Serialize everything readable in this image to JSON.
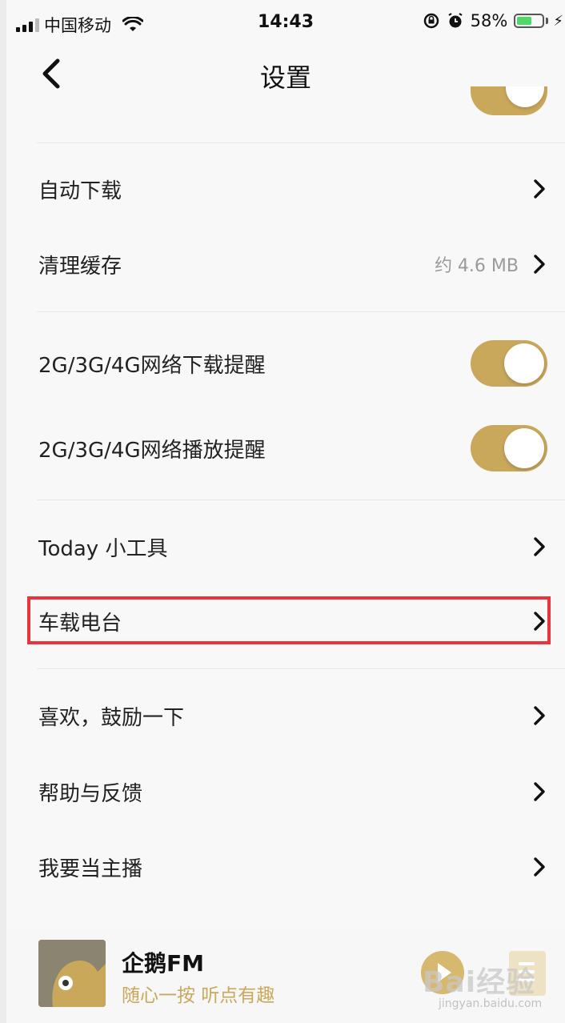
{
  "status_bar": {
    "carrier": "中国移动",
    "time": "14:43",
    "battery": "58%",
    "battery_level": 0.58
  },
  "nav": {
    "title": "设置"
  },
  "settings": {
    "auto_download": {
      "label": "自动下载"
    },
    "clear_cache": {
      "label": "清理缓存",
      "value": "约 4.6 MB"
    },
    "download_alert": {
      "label": "2G/3G/4G网络下载提醒",
      "on": true
    },
    "play_alert": {
      "label": "2G/3G/4G网络播放提醒",
      "on": true
    },
    "today_widget": {
      "label": "Today 小工具"
    },
    "car_radio": {
      "label": "车载电台"
    },
    "like_app": {
      "label": "喜欢，鼓励一下"
    },
    "help_feedback": {
      "label": "帮助与反馈"
    },
    "become_host": {
      "label": "我要当主播"
    }
  },
  "player": {
    "title": "企鹅FM",
    "subtitle": "随心一按 听点有趣"
  },
  "watermark": {
    "brand": "Bai经验",
    "url": "jingyan.baidu.com"
  },
  "colors": {
    "accent": "#c9a85c",
    "highlight": "#e8343c"
  }
}
